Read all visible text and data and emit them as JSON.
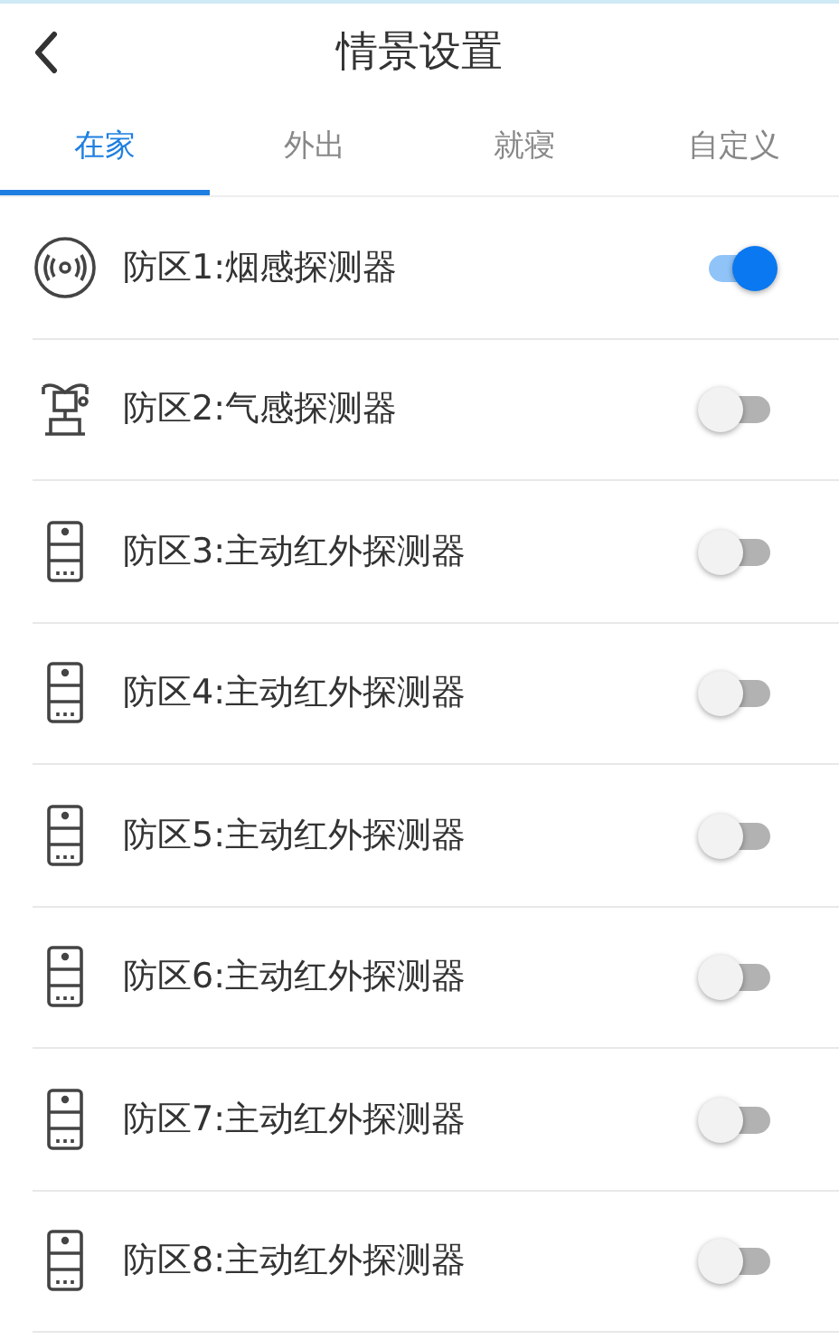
{
  "header": {
    "title": "情景设置"
  },
  "tabs": [
    {
      "label": "在家",
      "selected": true
    },
    {
      "label": "外出",
      "selected": false
    },
    {
      "label": "就寝",
      "selected": false
    },
    {
      "label": "自定义",
      "selected": false
    }
  ],
  "zones": [
    {
      "kind": "smoke",
      "name": "防区1:烟感探测器",
      "on": true
    },
    {
      "kind": "gas",
      "name": "防区2:气感探测器",
      "on": false
    },
    {
      "kind": "infrared",
      "name": "防区3:主动红外探测器",
      "on": false
    },
    {
      "kind": "infrared",
      "name": "防区4:主动红外探测器",
      "on": false
    },
    {
      "kind": "infrared",
      "name": "防区5:主动红外探测器",
      "on": false
    },
    {
      "kind": "infrared",
      "name": "防区6:主动红外探测器",
      "on": false
    },
    {
      "kind": "infrared",
      "name": "防区7:主动红外探测器",
      "on": false
    },
    {
      "kind": "infrared",
      "name": "防区8:主动红外探测器",
      "on": false
    }
  ]
}
